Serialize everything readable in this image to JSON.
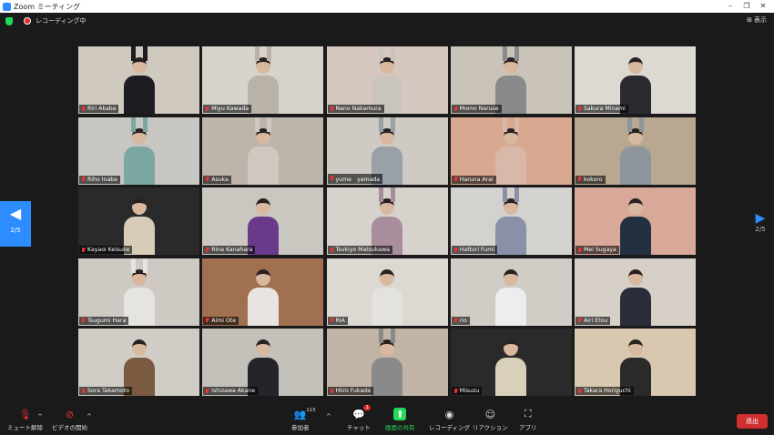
{
  "window": {
    "title": "Zoom ミーティング"
  },
  "topbar": {
    "recording_label": "レコーディング中",
    "view_label": "表示"
  },
  "pager": {
    "left_page": "2/5",
    "right_page": "2/5"
  },
  "participants": [
    {
      "name": "Riri Akaba",
      "bg": "#cfc9c0",
      "shirt": "#1c1c22",
      "arms": true
    },
    {
      "name": "Miyu Kawada",
      "bg": "#d8d4cc",
      "shirt": "#b8b2a8",
      "arms": true
    },
    {
      "name": "Nano Nakamura",
      "bg": "#d6c8c0",
      "shirt": "#c9c4bd",
      "arms": true
    },
    {
      "name": "Momo Naruse",
      "bg": "#c9c3b8",
      "shirt": "#8b8a8a",
      "arms": true
    },
    {
      "name": "Sakura Minami",
      "bg": "#dcd8d2",
      "shirt": "#2a2a30",
      "arms": false
    },
    {
      "name": "Riho Inaba",
      "bg": "#c8c6c2",
      "shirt": "#7aa8a0",
      "arms": true
    },
    {
      "name": "Asuka",
      "bg": "#bdb4aa",
      "shirt": "#d0c8c0",
      "arms": true
    },
    {
      "name": "yume　yamada",
      "bg": "#cfcac4",
      "shirt": "#9aa0a8",
      "arms": true
    },
    {
      "name": "Haruna Arai",
      "bg": "#d9a890",
      "shirt": "#d8b8a8",
      "arms": true
    },
    {
      "name": "kokoro",
      "bg": "#b8a890",
      "shirt": "#8e959c",
      "arms": true
    },
    {
      "name": "Kayaoi Keisuke",
      "bg": "#2a2a2a",
      "shirt": "#d8ccb8",
      "arms": false
    },
    {
      "name": "Rina Kanahara",
      "bg": "#cac6c0",
      "shirt": "#6a3a8a",
      "arms": false
    },
    {
      "name": "Tsukiyo Matsukawa",
      "bg": "#d8d2cc",
      "shirt": "#a88e9c",
      "arms": true
    },
    {
      "name": "Hattori Fumi",
      "bg": "#d4d2ce",
      "shirt": "#8a90a8",
      "arms": true
    },
    {
      "name": "Mei Sugaya",
      "bg": "#d8a898",
      "shirt": "#223040",
      "arms": false
    },
    {
      "name": "Tsugumi Hara",
      "bg": "#cec9c2",
      "shirt": "#e6e4e0",
      "arms": true
    },
    {
      "name": "Aimi Ote",
      "bg": "#a07050",
      "shirt": "#e8e4e0",
      "arms": false
    },
    {
      "name": "RIA",
      "bg": "#dcd8d2",
      "shirt": "#e4e2de",
      "arms": false
    },
    {
      "name": "rio",
      "bg": "#d0ccc6",
      "shirt": "#ededed",
      "arms": false
    },
    {
      "name": "Airi Etou",
      "bg": "#d6d0c8",
      "shirt": "#2a2c3a",
      "arms": false
    },
    {
      "name": "Sora Takamoto",
      "bg": "#d0ccc6",
      "shirt": "#7a5a40",
      "arms": false
    },
    {
      "name": "Ishizawa Akane",
      "bg": "#c4c0ba",
      "shirt": "#24242a",
      "arms": false
    },
    {
      "name": "Hiiro Fukada",
      "bg": "#c2b4a6",
      "shirt": "#8a8a8a",
      "arms": true
    },
    {
      "name": "Misuzu",
      "bg": "#2a2a2a",
      "shirt": "#d8d0b8",
      "arms": false
    },
    {
      "name": "Takara Horiguchi",
      "bg": "#d8c8b0",
      "shirt": "#2a2a2a",
      "arms": false
    }
  ],
  "toolbar": {
    "unmute_label": "ミュート解除",
    "video_label": "ビデオの開始",
    "participants_label": "参加者",
    "participants_count": "115",
    "chat_label": "チャット",
    "chat_badge": "1",
    "share_label": "画面の共有",
    "record_label": "レコーディング",
    "reactions_label": "リアクション",
    "apps_label": "アプリ",
    "leave_label": "退出"
  },
  "colors": {
    "accent": "#2d8cff",
    "share": "#23d959",
    "leave": "#cf2f2f",
    "muted": "#e83535"
  }
}
